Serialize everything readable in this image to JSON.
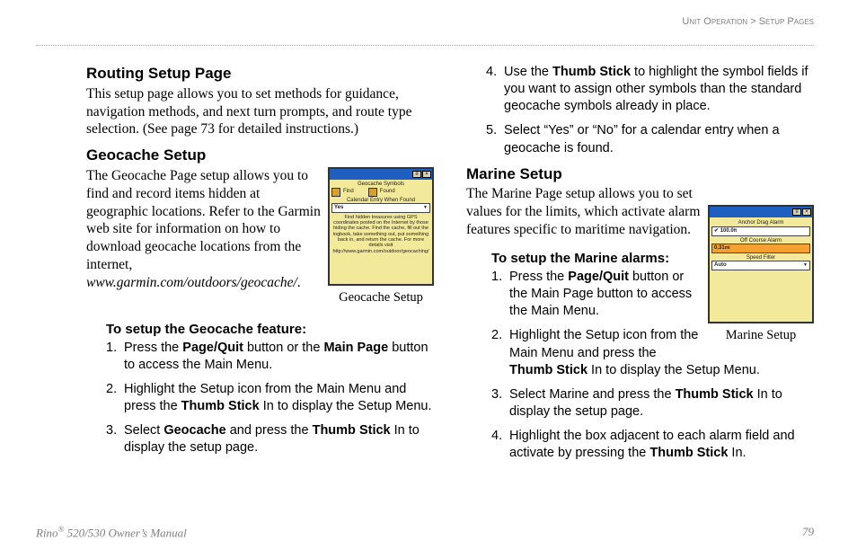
{
  "header": {
    "breadcrumb1": "Unit Operation",
    "sep": " > ",
    "breadcrumb2": "Setup Pages"
  },
  "left": {
    "routing_h": "Routing Setup Page",
    "routing_body": "This setup page allows you to set methods for  guidance, navigation methods, and next turn prompts, and route type selection. (See page 73 for detailed instructions.)",
    "geocache_h": "Geocache Setup",
    "geocache_body_1": "The Geocache Page setup allows you to find and record items hidden at geographic locations. Refer to the Garmin web site for information on how to download geocache locations from the internet, ",
    "geocache_url": "www.garmin.com/outdoors/geocache/",
    "geocache_body_end": ".",
    "fig1_caption": "Geocache Setup",
    "geo_subhead": "To setup the Geocache feature:",
    "geo_steps": [
      {
        "n": "1.",
        "pre": "Press the ",
        "b1": "Page/Quit",
        "mid": " button or the ",
        "b2": "Main Page",
        "post": " button to access the Main Menu."
      },
      {
        "n": "2.",
        "pre": "Highlight the Setup icon from the Main Menu and press the ",
        "b1": "Thumb Stick",
        "post": " In to display the Setup Menu."
      },
      {
        "n": "3.",
        "pre": "Select ",
        "b1": "Geocache",
        "mid": " and press the ",
        "b2": "Thumb Stick",
        "post": " In to display the setup page."
      }
    ],
    "screen1": {
      "lbl_symbols": "Geocache Symbols",
      "find": "Find",
      "found": "Found",
      "lbl_cal": "Calendar Entry When Found",
      "yes": "Yes",
      "desc": "Find hidden treasures using GPS coordinates posted on the Internet by those hiding the cache. Find the cache, fill out the logbook, take something out, put something back in, and return the cache. For more details visit http://www.garmin.com/outdoor/geocaching/"
    }
  },
  "right": {
    "cont_steps": [
      {
        "n": "4.",
        "pre": "Use the ",
        "b1": "Thumb Stick",
        "post": " to highlight the symbol fields if you want to assign other symbols than the standard geocache symbols already in place."
      },
      {
        "n": "5.",
        "pre": "Select “Yes” or “No” for a calendar entry when a geocache is found."
      }
    ],
    "marine_h": "Marine Setup",
    "marine_body": "The Marine Page setup allows you to set values for the limits, which activate alarm features specific to maritime navigation.",
    "fig2_caption": "Marine Setup",
    "marine_subhead": "To setup the Marine alarms:",
    "marine_steps": [
      {
        "n": "1.",
        "pre": "Press the ",
        "b1": "Page/Quit",
        "post": " button or the Main Page button to access the Main Menu."
      },
      {
        "n": "2.",
        "pre": "Highlight the Setup icon from the Main Menu and press the ",
        "b1": "Thumb Stick",
        "post": " In to display the Setup Menu."
      },
      {
        "n": "3.",
        "pre": "Select Marine and press the ",
        "b1": "Thumb Stick",
        "post": " In to display the setup page."
      },
      {
        "n": "4.",
        "pre": "Highlight the box adjacent to each alarm field and activate by pressing the ",
        "b1": "Thumb Stick",
        "post": " In."
      }
    ],
    "screen2": {
      "lbl_anchor": "Anchor Drag Alarm",
      "v_anchor": "100.0",
      "unit_anchor": "ft",
      "lbl_course": "Off Course Alarm",
      "v_course": "0.31",
      "unit_course": "mi",
      "lbl_speed": "Speed Filter",
      "v_speed": "Auto"
    }
  },
  "footer": {
    "product_pre": "Rino",
    "reg": "®",
    "product_post": " 520/530 Owner’s Manual",
    "page": "79"
  }
}
